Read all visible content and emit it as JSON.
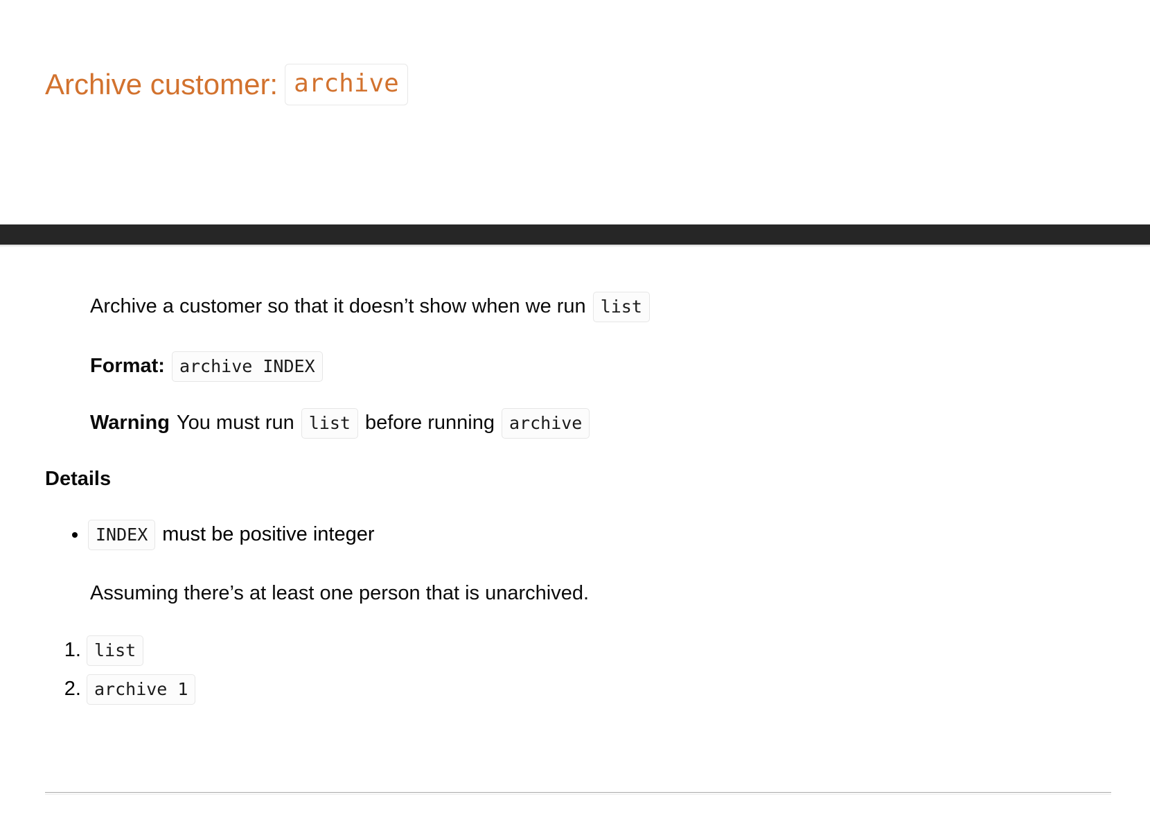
{
  "page": {
    "title_prefix": "Archive customer:",
    "title_code": "archive",
    "accent_color": "#d2722e",
    "navbar_color": "#262626",
    "text_color": "#0a0a0a",
    "chip_border_color": "#e6e6e6"
  },
  "content": {
    "intro": {
      "text_before": "Archive a customer so that it doesn’t show when we run",
      "code": "list"
    },
    "format": {
      "label": "Format:",
      "code": "archive INDEX"
    },
    "warning": {
      "label": "Warning",
      "text_before": "You must run",
      "code_1": "list",
      "text_middle": "before running",
      "code_2": "archive"
    },
    "details": {
      "heading": "Details",
      "items": [
        {
          "code": "INDEX",
          "text": "must be positive integer"
        }
      ]
    },
    "assumption": {
      "text": "Assuming there’s at least one person that is unarchived."
    },
    "steps": [
      {
        "marker": "1.",
        "code": "list"
      },
      {
        "marker": "2.",
        "code": "archive 1"
      }
    ]
  }
}
